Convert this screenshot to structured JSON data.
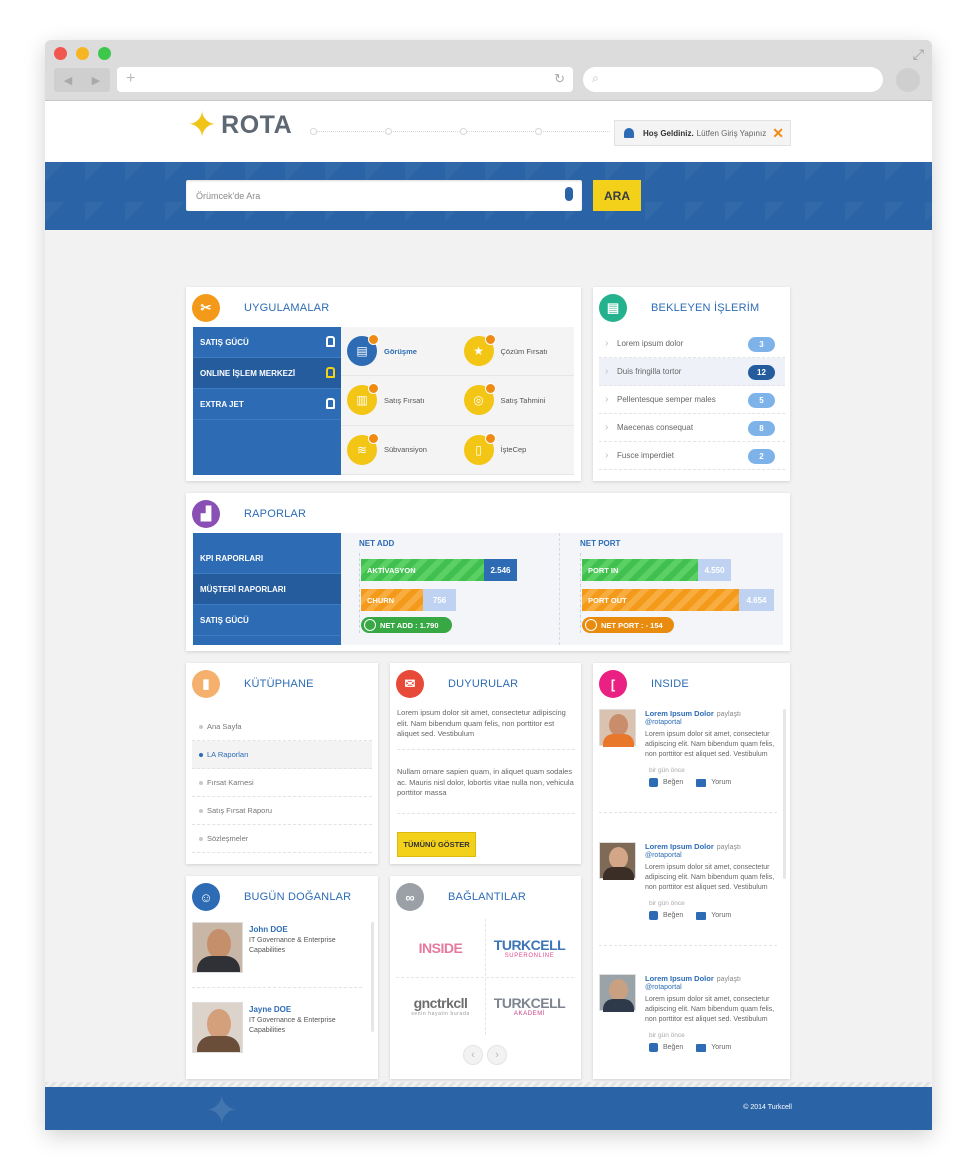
{
  "browser": {
    "back": "◀",
    "forward": "▶",
    "new_tab": "+",
    "reload": "↻",
    "search_icon": "⌕",
    "expand": "⤢"
  },
  "header": {
    "logo_text": "ROTA",
    "login_bold": "Hoş Geldiniz.",
    "login_text": "Lütfen Giriş Yapınız",
    "close": "✕"
  },
  "search": {
    "placeholder": "Örümcek'de Ara",
    "button": "ARA"
  },
  "apps": {
    "title": "UYGULAMALAR",
    "menu": [
      {
        "label": "SATIŞ GÜCÜ"
      },
      {
        "label": "ONLINE İŞLEM MERKEZİ"
      },
      {
        "label": "EXTRA JET"
      }
    ],
    "items": [
      {
        "label": "Görüşme",
        "icon": "chat-icon",
        "color": "#2d6cb5"
      },
      {
        "label": "Çözüm Fırsatı",
        "icon": "star-icon",
        "color": "#f3c514"
      },
      {
        "label": "Satış Fırsatı",
        "icon": "document-icon",
        "color": "#f3c514"
      },
      {
        "label": "Satış Tahmini",
        "icon": "target-icon",
        "color": "#f3c514"
      },
      {
        "label": "Sübvansiyon",
        "icon": "layers-icon",
        "color": "#f3c514"
      },
      {
        "label": "İşteCep",
        "icon": "phone-icon",
        "color": "#f3c514"
      }
    ]
  },
  "pending": {
    "title": "BEKLEYEN İŞLERİM",
    "items": [
      {
        "label": "Lorem ipsum dolor",
        "count": "3"
      },
      {
        "label": "Duis fringilla tortor",
        "count": "12"
      },
      {
        "label": "Pellentesque semper males",
        "count": "5"
      },
      {
        "label": "Maecenas consequat",
        "count": "8"
      },
      {
        "label": "Fusce imperdiet",
        "count": "2"
      }
    ]
  },
  "reports": {
    "title": "RAPORLAR",
    "menu": [
      {
        "label": "KPI RAPORLARI"
      },
      {
        "label": "MÜŞTERİ RAPORLARI"
      },
      {
        "label": "SATIŞ GÜCÜ"
      }
    ],
    "net_add": {
      "title": "NET ADD",
      "bar1_label": "AKTİVASYON",
      "bar1_value": "2.546",
      "bar2_label": "CHURN",
      "bar2_value": "756",
      "summary": "NET ADD : 1.790"
    },
    "net_port": {
      "title": "NET PORT",
      "bar1_label": "PORT IN",
      "bar1_value": "4.550",
      "bar2_label": "PORT OUT",
      "bar2_value": "4.654",
      "summary": "NET PORT : - 154"
    }
  },
  "library": {
    "title": "KÜTÜPHANE",
    "items": [
      {
        "label": "Ana Sayfa"
      },
      {
        "label": "LA Raporları"
      },
      {
        "label": "Fırsat Karnesi"
      },
      {
        "label": "Satış Fırsat Raporu"
      },
      {
        "label": "Sözleşmeler"
      }
    ]
  },
  "news": {
    "title": "DUYURULAR",
    "p1": "Lorem ipsum dolor sit amet, consectetur adipiscing elit. Nam bibendum quam felis, non porttitor est aliquet sed. Vestibulum",
    "p2": "Nullam ornare sapien quam, in aliquet quam sodales ac. Mauris nisl dolor, lobortis vitae nulla non, vehicula porttitor massa",
    "button": "TÜMÜNÜ GÖSTER"
  },
  "inside": {
    "title": "INSIDE",
    "posts": [
      {
        "name": "Lorem Ipsum Dolor",
        "verb": "paylaştı",
        "handle": "@rotaportal",
        "text": "Lorem ipsum dolor sit amet, consectetur adipiscing elit. Nam bibendum quam felis, non porttitor est aliquet sed. Vestibulum",
        "time": "bir gün önce",
        "like": "Beğen",
        "comment": "Yorum"
      },
      {
        "name": "Lorem Ipsum Dolor",
        "verb": "paylaştı",
        "handle": "@rotaportal",
        "text": "Lorem ipsum dolor sit amet, consectetur adipiscing elit. Nam bibendum quam felis, non porttitor est aliquet sed. Vestibulum",
        "time": "bir gün önce",
        "like": "Beğen",
        "comment": "Yorum"
      },
      {
        "name": "Lorem Ipsum Dolor",
        "verb": "paylaştı",
        "handle": "@rotaportal",
        "text": "Lorem ipsum dolor sit amet, consectetur adipiscing elit. Nam bibendum quam felis, non porttitor est aliquet sed. Vestibulum",
        "time": "bir gün önce",
        "like": "Beğen",
        "comment": "Yorum"
      }
    ]
  },
  "birthdays": {
    "title": "BUGÜN DOĞANLAR",
    "people": [
      {
        "name": "John DOE",
        "desc": "IT Governance & Enterprise Capabilities"
      },
      {
        "name": "Jayne DOE",
        "desc": "IT Governance & Enterprise Capabilities"
      }
    ]
  },
  "links": {
    "title": "BAĞLANTILAR",
    "items": [
      {
        "a": "INSIDE",
        "b": ""
      },
      {
        "a": "TURKCELL",
        "b": "SUPERONLINE"
      },
      {
        "a": "gnctrkcll",
        "b": "senin hayatin burada"
      },
      {
        "a": "TURKCELL",
        "b": "AKADEMİ"
      }
    ],
    "prev": "‹",
    "next": "›"
  },
  "footer": {
    "copyright": "© 2014 Turkcell"
  },
  "colors": {
    "brand_blue": "#2a64a6",
    "accent_yellow": "#f3d11b",
    "green": "#42c04f",
    "orange": "#f39a1a"
  }
}
